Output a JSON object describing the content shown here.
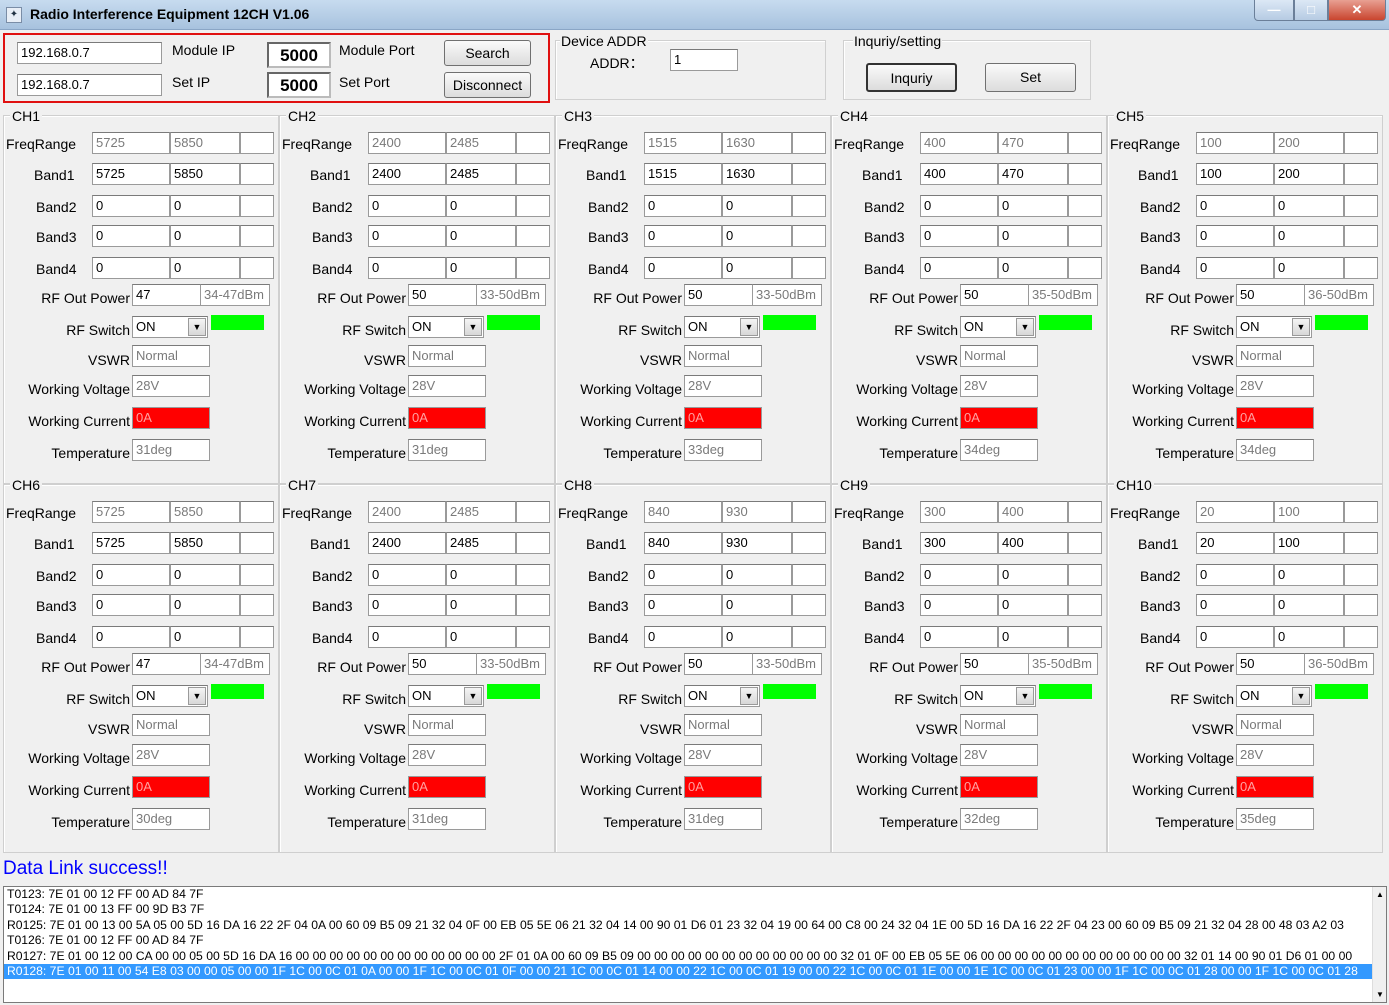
{
  "window": {
    "title": "Radio Interference Equipment 12CH V1.06",
    "min": "—",
    "max": "□",
    "close": "✕"
  },
  "connection": {
    "module_ip": "192.168.0.7",
    "module_ip_label": "Module IP",
    "module_port": "5000",
    "module_port_label": "Module Port",
    "set_ip": "192.168.0.7",
    "set_ip_label": "Set IP",
    "set_port": "5000",
    "set_port_label": "Set Port",
    "search_label": "Search",
    "disconnect_label": "Disconnect"
  },
  "device": {
    "group_label": "Device ADDR",
    "addr_label": "ADDR：",
    "addr_value": "1"
  },
  "inquiry": {
    "group_label": "Inquriy/setting",
    "inquiry_label": "Inquriy",
    "set_label": "Set"
  },
  "labels": {
    "freq_range": "FreqRange",
    "band1": "Band1",
    "band2": "Band2",
    "band3": "Band3",
    "band4": "Band4",
    "rf_out_power": "RF Out Power",
    "rf_switch": "RF Switch",
    "vswr": "VSWR",
    "working_voltage": "Working Voltage",
    "working_current": "Working Current",
    "temperature": "Temperature"
  },
  "colors": {
    "switch_on": "#00ff00",
    "current_alarm": "#ff0000",
    "status_text": "#0000ff",
    "highlight": "#3399ff"
  },
  "channels": [
    {
      "name": "CH1",
      "freq": [
        "5725",
        "5850"
      ],
      "band1": [
        "5725",
        "5850"
      ],
      "band2": [
        "0",
        "0"
      ],
      "band3": [
        "0",
        "0"
      ],
      "band4": [
        "0",
        "0"
      ],
      "power": "47",
      "power_range": "34-47dBm",
      "switch": "ON",
      "vswr": "Normal",
      "voltage": "28V",
      "current": "0A",
      "temp": "31deg"
    },
    {
      "name": "CH2",
      "freq": [
        "2400",
        "2485"
      ],
      "band1": [
        "2400",
        "2485"
      ],
      "band2": [
        "0",
        "0"
      ],
      "band3": [
        "0",
        "0"
      ],
      "band4": [
        "0",
        "0"
      ],
      "power": "50",
      "power_range": "33-50dBm",
      "switch": "ON",
      "vswr": "Normal",
      "voltage": "28V",
      "current": "0A",
      "temp": "31deg"
    },
    {
      "name": "CH3",
      "freq": [
        "1515",
        "1630"
      ],
      "band1": [
        "1515",
        "1630"
      ],
      "band2": [
        "0",
        "0"
      ],
      "band3": [
        "0",
        "0"
      ],
      "band4": [
        "0",
        "0"
      ],
      "power": "50",
      "power_range": "33-50dBm",
      "switch": "ON",
      "vswr": "Normal",
      "voltage": "28V",
      "current": "0A",
      "temp": "33deg"
    },
    {
      "name": "CH4",
      "freq": [
        "400",
        "470"
      ],
      "band1": [
        "400",
        "470"
      ],
      "band2": [
        "0",
        "0"
      ],
      "band3": [
        "0",
        "0"
      ],
      "band4": [
        "0",
        "0"
      ],
      "power": "50",
      "power_range": "35-50dBm",
      "switch": "ON",
      "vswr": "Normal",
      "voltage": "28V",
      "current": "0A",
      "temp": "34deg"
    },
    {
      "name": "CH5",
      "freq": [
        "100",
        "200"
      ],
      "band1": [
        "100",
        "200"
      ],
      "band2": [
        "0",
        "0"
      ],
      "band3": [
        "0",
        "0"
      ],
      "band4": [
        "0",
        "0"
      ],
      "power": "50",
      "power_range": "36-50dBm",
      "switch": "ON",
      "vswr": "Normal",
      "voltage": "28V",
      "current": "0A",
      "temp": "34deg"
    },
    {
      "name": "CH6",
      "freq": [
        "5725",
        "5850"
      ],
      "band1": [
        "5725",
        "5850"
      ],
      "band2": [
        "0",
        "0"
      ],
      "band3": [
        "0",
        "0"
      ],
      "band4": [
        "0",
        "0"
      ],
      "power": "47",
      "power_range": "34-47dBm",
      "switch": "ON",
      "vswr": "Normal",
      "voltage": "28V",
      "current": "0A",
      "temp": "30deg"
    },
    {
      "name": "CH7",
      "freq": [
        "2400",
        "2485"
      ],
      "band1": [
        "2400",
        "2485"
      ],
      "band2": [
        "0",
        "0"
      ],
      "band3": [
        "0",
        "0"
      ],
      "band4": [
        "0",
        "0"
      ],
      "power": "50",
      "power_range": "33-50dBm",
      "switch": "ON",
      "vswr": "Normal",
      "voltage": "28V",
      "current": "0A",
      "temp": "31deg"
    },
    {
      "name": "CH8",
      "freq": [
        "840",
        "930"
      ],
      "band1": [
        "840",
        "930"
      ],
      "band2": [
        "0",
        "0"
      ],
      "band3": [
        "0",
        "0"
      ],
      "band4": [
        "0",
        "0"
      ],
      "power": "50",
      "power_range": "33-50dBm",
      "switch": "ON",
      "vswr": "Normal",
      "voltage": "28V",
      "current": "0A",
      "temp": "31deg"
    },
    {
      "name": "CH9",
      "freq": [
        "300",
        "400"
      ],
      "band1": [
        "300",
        "400"
      ],
      "band2": [
        "0",
        "0"
      ],
      "band3": [
        "0",
        "0"
      ],
      "band4": [
        "0",
        "0"
      ],
      "power": "50",
      "power_range": "35-50dBm",
      "switch": "ON",
      "vswr": "Normal",
      "voltage": "28V",
      "current": "0A",
      "temp": "32deg"
    },
    {
      "name": "CH10",
      "freq": [
        "20",
        "100"
      ],
      "band1": [
        "20",
        "100"
      ],
      "band2": [
        "0",
        "0"
      ],
      "band3": [
        "0",
        "0"
      ],
      "band4": [
        "0",
        "0"
      ],
      "power": "50",
      "power_range": "36-50dBm",
      "switch": "ON",
      "vswr": "Normal",
      "voltage": "28V",
      "current": "0A",
      "temp": "35deg"
    }
  ],
  "status": "Data Link success!!",
  "log": [
    "T0123: 7E 01 00 12 FF 00  AD 84 7F",
    "T0124: 7E 01 00 13 FF 00  9D B3 7F",
    "R0125: 7E 01 00 13 00 5A  05 00 5D 16 DA 16 22 2F 04 0A 00 60 09 B5 09 21 32 04 0F 00 EB 05 5E 06 21 32 04 14 00 90 01 D6 01 23 32 04 19 00 64 00 C8 00 24 32 04 1E 00 5D 16 DA 16 22 2F 04 23 00 60 09 B5 09 21 32 04 28 00 48 03 A2 03",
    "T0126: 7E 01 00 12 FF 00  AD 84 7F",
    "R0127: 7E 01 00 12 00 CA  00 00 05 00 5D 16 DA 16 00 00 00 00 00 00 00 00 00 00 00 00 2F 01 0A 00 60 09 B5 09 00 00 00 00 00 00 00 00 00 00 00 00 32 01 0F 00 EB 05 5E 06 00 00 00 00 00 00 00 00 00 00 00 00 32 01 14 00 90 01 D6 01 00 00",
    "R0128: 7E 01 00 11 00 54  E8 03 00 00 05 00 00 1F 1C 00 0C 01 0A 00 00 1F 1C 00 0C 01 0F 00 00 21 1C 00 0C 01 14 00 00 22 1C 00 0C 01 19 00 00 22 1C 00 0C 01 1E 00 00 1E 1C 00 0C 01 23 00 00 1F 1C 00 0C 01 28 00 00 1F 1C 00 0C 01 28"
  ],
  "log_selected_index": 5
}
